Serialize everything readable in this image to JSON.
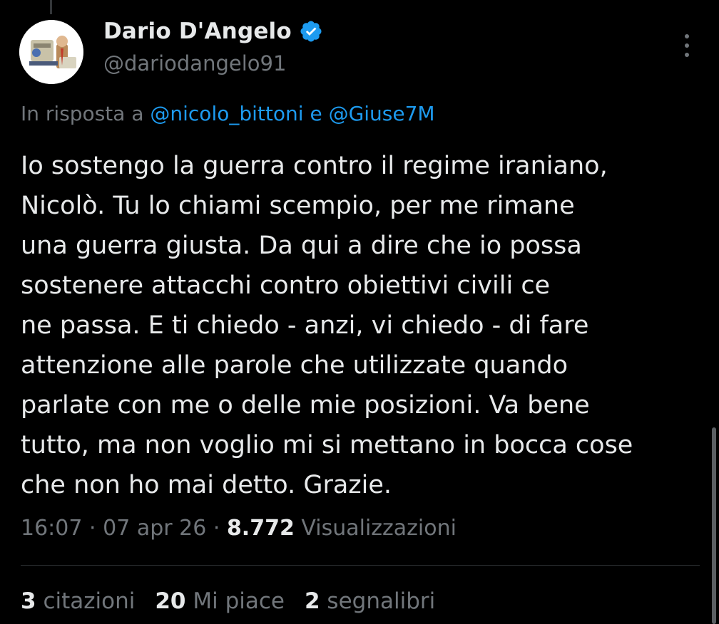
{
  "author": {
    "display_name": "Dario D'Angelo",
    "handle": "@dariodangelo91",
    "verified": true,
    "verified_color": "#1d9bf0"
  },
  "reply": {
    "prefix": "In risposta a",
    "mention_1": "@nicolo_bittoni",
    "conjunction": "e",
    "mention_2": "@Giuse7M"
  },
  "tweet": {
    "lines": [
      "Io sostengo la guerra contro il regime iraniano,",
      "Nicolò. Tu lo chiami scempio, per me rimane",
      "una guerra giusta. Da qui a dire che io possa",
      "sostenere attacchi contro obiettivi civili ce",
      "ne passa. E ti chiedo - anzi, vi chiedo - di fare",
      "attenzione alle parole che utilizzate quando",
      "parlate con me o delle mie posizioni. Va bene",
      "tutto, ma non voglio mi si mettano in bocca cose",
      "che non ho mai detto. Grazie."
    ]
  },
  "meta": {
    "time": "16:07",
    "separator": "·",
    "date": "07 apr 26",
    "views_count": "8.772",
    "views_label": "Visualizzazioni"
  },
  "stats": {
    "quotes_count": "3",
    "quotes_label": "citazioni",
    "likes_count": "20",
    "likes_label": "Mi piace",
    "bookmarks_count": "2",
    "bookmarks_label": "segnalibri"
  },
  "icons": {
    "more": "more-vertical-icon",
    "verified": "verified-badge-icon"
  },
  "colors": {
    "background": "#000000",
    "primary_text": "#e7e9ea",
    "secondary_text": "#71767b",
    "link": "#1d9bf0",
    "divider": "#2f3336"
  }
}
